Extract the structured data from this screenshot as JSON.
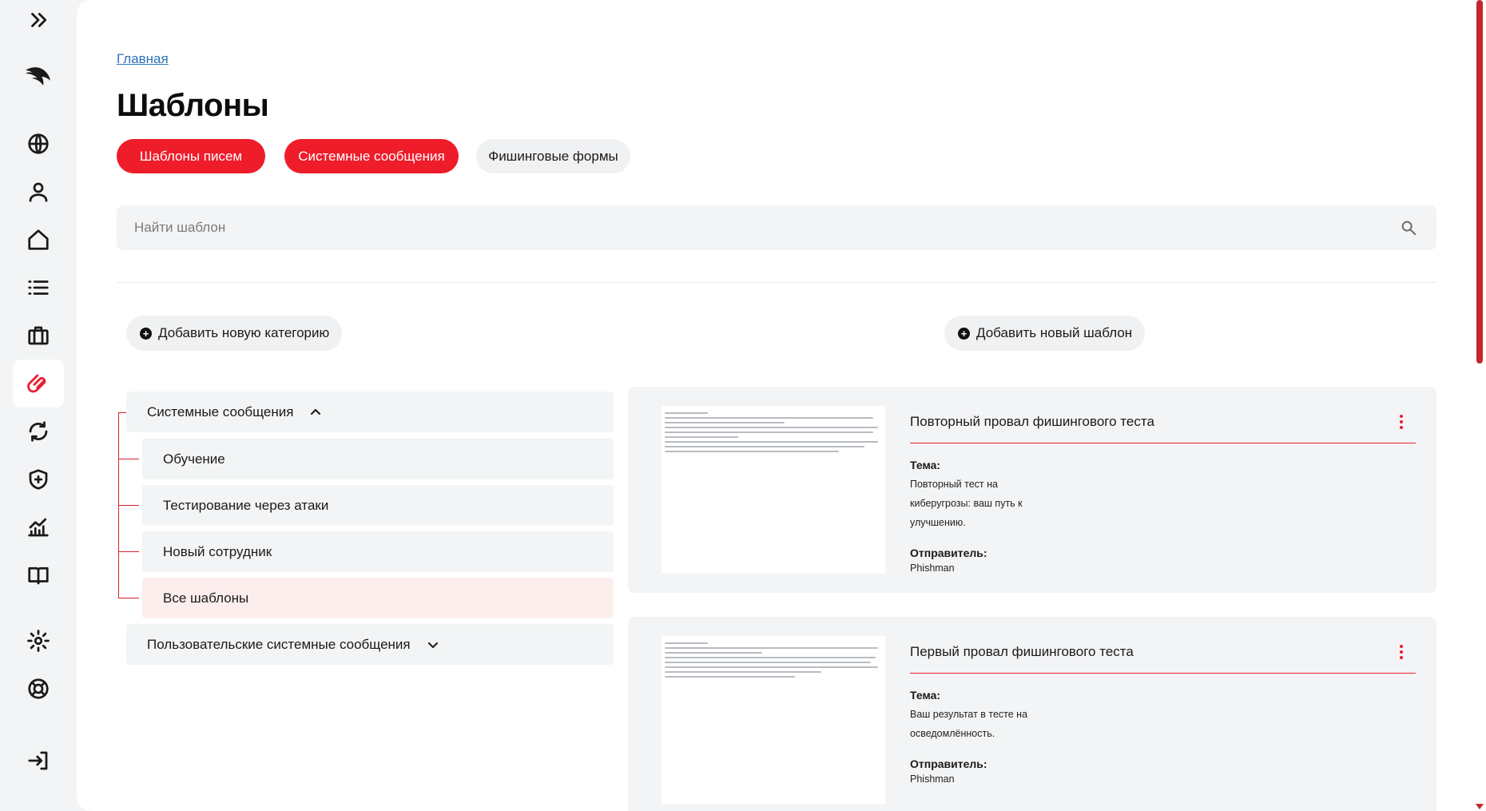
{
  "sidebar": {
    "items": [
      {
        "name": "expand-icon"
      },
      {
        "name": "logo-icon"
      },
      {
        "name": "globe-icon"
      },
      {
        "name": "user-icon"
      },
      {
        "name": "home-icon"
      },
      {
        "name": "list-icon"
      },
      {
        "name": "briefcase-icon"
      },
      {
        "name": "paperclip-icon",
        "active": true
      },
      {
        "name": "refresh-icon"
      },
      {
        "name": "shield-plus-icon"
      },
      {
        "name": "analytics-icon"
      },
      {
        "name": "book-icon"
      },
      {
        "name": "gear-icon"
      },
      {
        "name": "lifebuoy-icon"
      },
      {
        "name": "logout-icon"
      }
    ]
  },
  "breadcrumb": "Главная",
  "page_title": "Шаблоны",
  "tabs": [
    {
      "label": "Шаблоны писем",
      "style": "red"
    },
    {
      "label": "Системные сообщения",
      "style": "red"
    },
    {
      "label": "Фишинговые формы",
      "style": "grey"
    }
  ],
  "search": {
    "placeholder": "Найти шаблон",
    "value": ""
  },
  "add_category_label": "Добавить новую категорию",
  "add_template_label": "Добавить новый шаблон",
  "categories": {
    "system": {
      "label": "Системные сообщения",
      "children": [
        "Обучение",
        "Тестирование через атаки",
        "Новый сотрудник",
        "Все шаблоны"
      ],
      "selected": "Все шаблоны"
    },
    "custom": {
      "label": "Пользовательские системные сообщения"
    }
  },
  "templates": [
    {
      "title": "Повторный провал фишингового теста",
      "subject_label": "Тема:",
      "subject": "Повторный тест на киберугрозы: ваш путь к улучшению.",
      "sender_label": "Отправитель:",
      "sender": "Phishman"
    },
    {
      "title": "Первый провал фишингового теста",
      "subject_label": "Тема:",
      "subject": "Ваш результат в тесте на осведомлённость.",
      "sender_label": "Отправитель:",
      "sender": "Phishman"
    }
  ],
  "colors": {
    "accent": "#ef1c2a",
    "background": "#f3f4f5",
    "link": "#2b73b8"
  }
}
